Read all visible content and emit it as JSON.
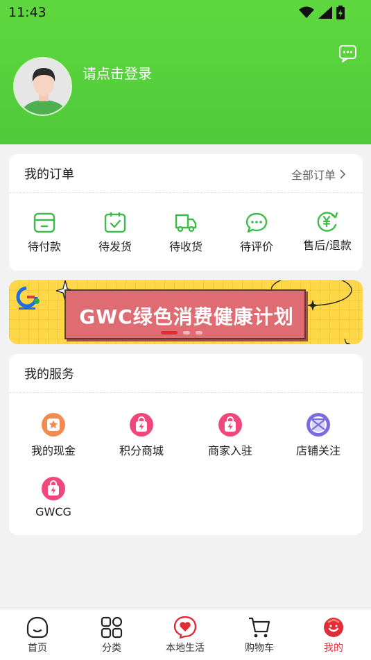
{
  "status_bar": {
    "time": "11:43"
  },
  "profile": {
    "login_prompt": "请点击登录"
  },
  "orders": {
    "title": "我的订单",
    "all_orders": "全部订单",
    "items": [
      {
        "label": "待付款",
        "icon": "wallet-icon"
      },
      {
        "label": "待发货",
        "icon": "package-check-icon"
      },
      {
        "label": "待收货",
        "icon": "delivery-truck-icon"
      },
      {
        "label": "待评价",
        "icon": "chat-bubble-icon"
      },
      {
        "label": "售后/退款",
        "icon": "refund-yen-icon"
      }
    ]
  },
  "banner": {
    "text": "GWC绿色消费健康计划",
    "slide_count": 3,
    "active_slide": 1
  },
  "services": {
    "title": "我的服务",
    "items": [
      {
        "label": "我的现金",
        "icon": "star-badge-icon",
        "color": "#f28a52"
      },
      {
        "label": "积分商城",
        "icon": "shopping-bag-bolt-icon",
        "color": "#f0487a"
      },
      {
        "label": "商家入驻",
        "icon": "shopping-bag-bolt-icon",
        "color": "#f0487a"
      },
      {
        "label": "店铺关注",
        "icon": "compass-icon",
        "color": "#7a6ce0"
      },
      {
        "label": "GWCG",
        "icon": "shopping-bag-bolt-icon",
        "color": "#f0487a"
      }
    ]
  },
  "tabbar": {
    "items": [
      {
        "label": "首页",
        "icon": "home-face-icon"
      },
      {
        "label": "分类",
        "icon": "category-grid-icon"
      },
      {
        "label": "本地生活",
        "icon": "heart-bubble-icon"
      },
      {
        "label": "购物车",
        "icon": "shopping-cart-icon"
      },
      {
        "label": "我的",
        "icon": "profile-mascot-icon"
      }
    ],
    "active": "我的"
  },
  "colors": {
    "header_green": "#5fd83f",
    "accent_red": "#e02d36",
    "order_icon_green": "#3dbb4a"
  }
}
